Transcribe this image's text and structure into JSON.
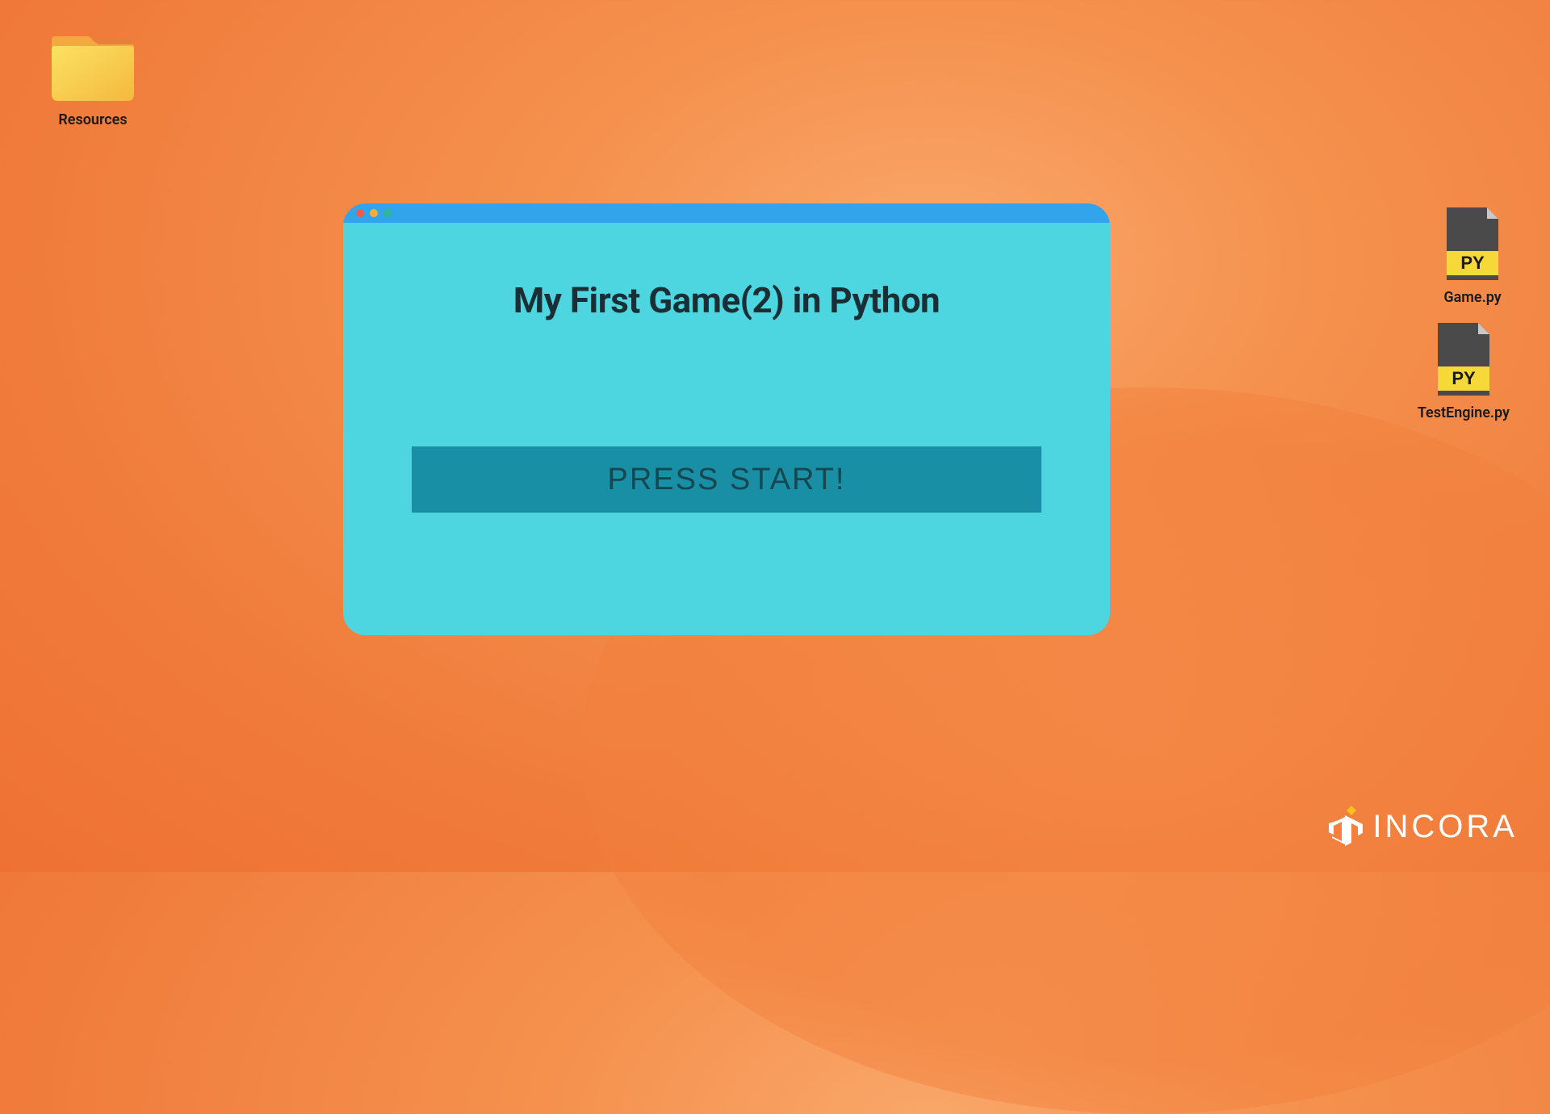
{
  "desktop": {
    "folder": {
      "label": "Resources"
    },
    "files": [
      {
        "label": "Game.py",
        "badge": "PY"
      },
      {
        "label": "TestEngine.py",
        "badge": "PY"
      }
    ]
  },
  "window": {
    "title": "My First Game(2) in Python",
    "start_button": "PRESS START!",
    "colors": {
      "titlebar": "#31a4ec",
      "body": "#4dd6e0",
      "button": "#188fa5"
    }
  },
  "brand": {
    "name": "INCORA",
    "accent": "#f6c21b"
  }
}
